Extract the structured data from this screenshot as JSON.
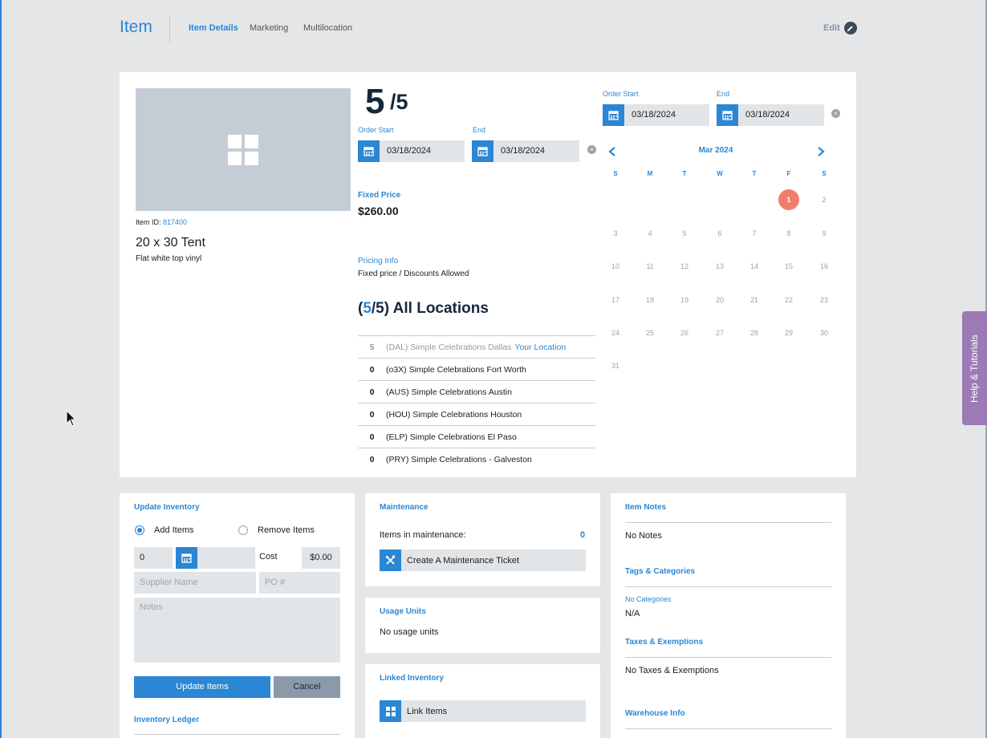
{
  "header": {
    "title": "Item",
    "tabs": [
      {
        "label": "Item Details",
        "active": true
      },
      {
        "label": "Marketing",
        "active": false
      },
      {
        "label": "Multilocation",
        "active": false
      }
    ],
    "edit_label": "Edit"
  },
  "item": {
    "id_label": "Item ID:",
    "id_value": "817400",
    "name": "20 x 30 Tent",
    "description": "Flat white top vinyl",
    "image_icon": "grid-icon"
  },
  "availability": {
    "available": "5",
    "total": "/5",
    "order_start_label": "Order Start",
    "end_label": "End",
    "order_start": "03/18/2024",
    "end": "03/18/2024"
  },
  "pricing": {
    "fixed_label": "Fixed Price",
    "fixed_value": "$260.00",
    "info_label": "Pricing Info",
    "info_value": "Fixed price / Discounts Allowed"
  },
  "locations": {
    "heading_open": "(",
    "heading_available": "5",
    "heading_rest": "/5) All Locations",
    "rows": [
      {
        "count": "5",
        "name": "(DAL) Simple Celebrations Dallas",
        "tag": "Your Location",
        "mine": true
      },
      {
        "count": "0",
        "name": "(o3X) Simple Celebrations Fort Worth",
        "tag": "",
        "mine": false
      },
      {
        "count": "0",
        "name": "(AUS) Simple Celebrations Austin",
        "tag": "",
        "mine": false
      },
      {
        "count": "0",
        "name": "(HOU) Simple Celebrations Houston",
        "tag": "",
        "mine": false
      },
      {
        "count": "0",
        "name": "(ELP) Simple Celebrations El Paso",
        "tag": "",
        "mine": false
      },
      {
        "count": "0",
        "name": "(PRY) Simple Celebrations - Galveston",
        "tag": "",
        "mine": false
      }
    ]
  },
  "calendar": {
    "order_start_label": "Order Start",
    "end_label": "End",
    "order_start": "03/18/2024",
    "end": "03/18/2024",
    "month": "Mar 2024",
    "weekdays": [
      "S",
      "M",
      "T",
      "W",
      "T",
      "F",
      "S"
    ],
    "first_weekday_index": 5,
    "days_in_month": 31,
    "selected_day": 1
  },
  "help_tab": {
    "label": "Help & Tutorials"
  },
  "update_inventory": {
    "title": "Update Inventory",
    "add_label": "Add Items",
    "remove_label": "Remove Items",
    "mode": "add",
    "quantity": "0",
    "cost_label": "Cost",
    "cost_value": "$0.00",
    "supplier_placeholder": "Supplier Name",
    "po_placeholder": "PO #",
    "notes_placeholder": "Notes",
    "update_button": "Update Items",
    "cancel_button": "Cancel",
    "ledger_title": "Inventory Ledger"
  },
  "maintenance": {
    "title": "Maintenance",
    "count_label": "Items in maintenance:",
    "count_value": "0",
    "ticket_button": "Create A Maintenance Ticket"
  },
  "usage_units": {
    "title": "Usage Units",
    "value": "No usage units"
  },
  "linked_inventory": {
    "title": "Linked Inventory",
    "button": "Link Items"
  },
  "notes_panel": {
    "notes_title": "Item Notes",
    "notes_value": "No Notes",
    "tags_title": "Tags & Categories",
    "categories_label": "No Categories",
    "categories_value": "N/A",
    "taxes_title": "Taxes & Exemptions",
    "taxes_value": "No Taxes & Exemptions",
    "warehouse_title": "Warehouse Info"
  },
  "colors": {
    "accent": "#2b86d4",
    "selected_day": "#ef7f6c",
    "help_tab": "#9c7ab5",
    "page_bg": "#e4e6e8"
  }
}
